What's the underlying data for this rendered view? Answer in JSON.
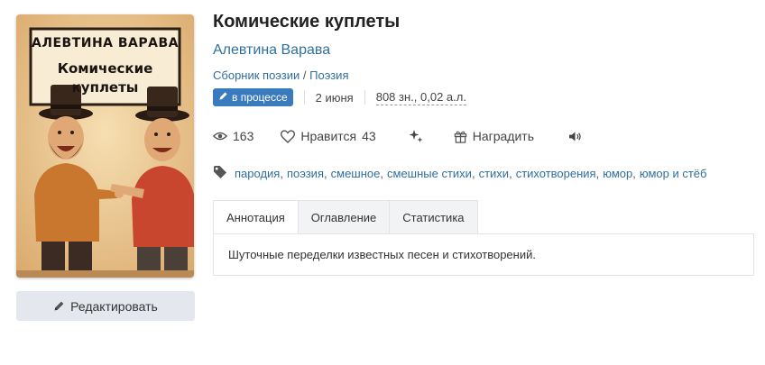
{
  "book": {
    "title": "Комические куплеты",
    "author": "Алевтина Варава",
    "genre_prefix": "Сборник поэзии",
    "genre_sep": "/",
    "genre_link": "Поэзия"
  },
  "cover": {
    "author_text": "АЛЕВТИНА ВАРАВА",
    "title_line1": "Комические",
    "title_line2": "куплеты"
  },
  "meta": {
    "status": "в процессе",
    "date": "2 июня",
    "size": "808 зн., 0,02 а.л."
  },
  "stats": {
    "views": "163",
    "likes_label": "Нравится",
    "likes_count": "43",
    "reward_label": "Наградить"
  },
  "tags": [
    "пародия",
    "поэзия",
    "смешное",
    "смешные стихи",
    "стихи",
    "стихотворения",
    "юмор",
    "юмор и стёб"
  ],
  "tabs": [
    "Аннотация",
    "Оглавление",
    "Статистика"
  ],
  "annotation": "Шуточные переделки известных песен и стихотворений.",
  "edit_button": "Редактировать",
  "icons": {
    "pencil": "pencil-icon",
    "eye": "eye-icon",
    "heart": "heart-icon",
    "sparkles": "sparkles-icon",
    "gift": "gift-icon",
    "speaker": "speaker-icon",
    "tag": "tag-icon"
  },
  "colors": {
    "link": "#2f6f9f",
    "badge": "#3a7bbd",
    "button_bg": "#e4e8ee"
  }
}
